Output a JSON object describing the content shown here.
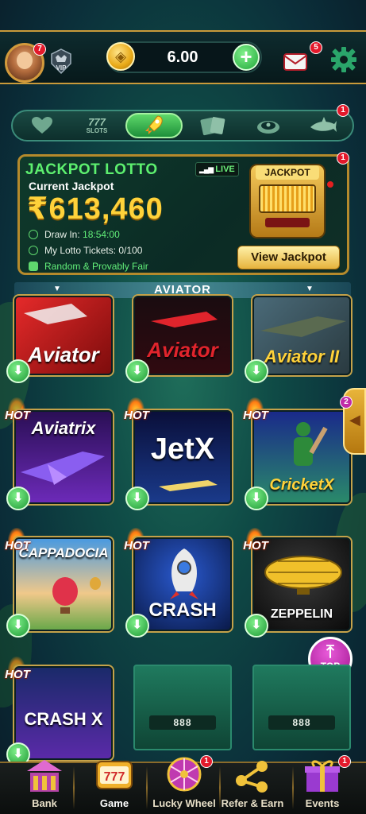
{
  "header": {
    "avatar_badge": "7",
    "vip_label": "VIP",
    "balance": "6.00",
    "mail_badge": "5"
  },
  "categories": {
    "slots_label": "SLOTS",
    "slots_number": "777",
    "badge": "1"
  },
  "jackpot": {
    "badge": "1",
    "title": "JACKPOT LOTTO",
    "live_label": "LIVE",
    "current_label": "Current Jackpot",
    "amount": "₹613,460",
    "draw_label": "Draw In:",
    "draw_value": "18:54:00",
    "tickets_label": "My Lotto Tickets:",
    "tickets_value": "0/100",
    "fair_label": "Random & Provably Fair",
    "machine_label": "JACKPOT",
    "view_button": "View Jackpot"
  },
  "section": {
    "title": "AVIATOR"
  },
  "games": [
    {
      "name": "Aviator",
      "hot": false
    },
    {
      "name": "Aviator",
      "hot": false
    },
    {
      "name": "Aviator II",
      "hot": false
    },
    {
      "name": "Aviatrix",
      "hot": true
    },
    {
      "name": "JetX",
      "hot": true
    },
    {
      "name": "CricketX",
      "hot": true
    },
    {
      "name": "CAPPADOCIA",
      "hot": true
    },
    {
      "name": "CRASH",
      "hot": true
    },
    {
      "name": "ZEPPELIN",
      "hot": true
    },
    {
      "name": "CRASH X",
      "hot": true
    }
  ],
  "hot_label": "HOT",
  "curtain_label": "888",
  "side_tab_badge": "2",
  "top_button": "TOP",
  "bottom_nav": [
    {
      "label": "Bank"
    },
    {
      "label": "Game"
    },
    {
      "label": "Lucky Wheel",
      "badge": "1"
    },
    {
      "label": "Refer & Earn"
    },
    {
      "label": "Events",
      "badge": "1"
    }
  ],
  "colors": {
    "accent_green": "#5df06f",
    "gold": "#ffd23a",
    "badge_red": "#e3192b"
  }
}
